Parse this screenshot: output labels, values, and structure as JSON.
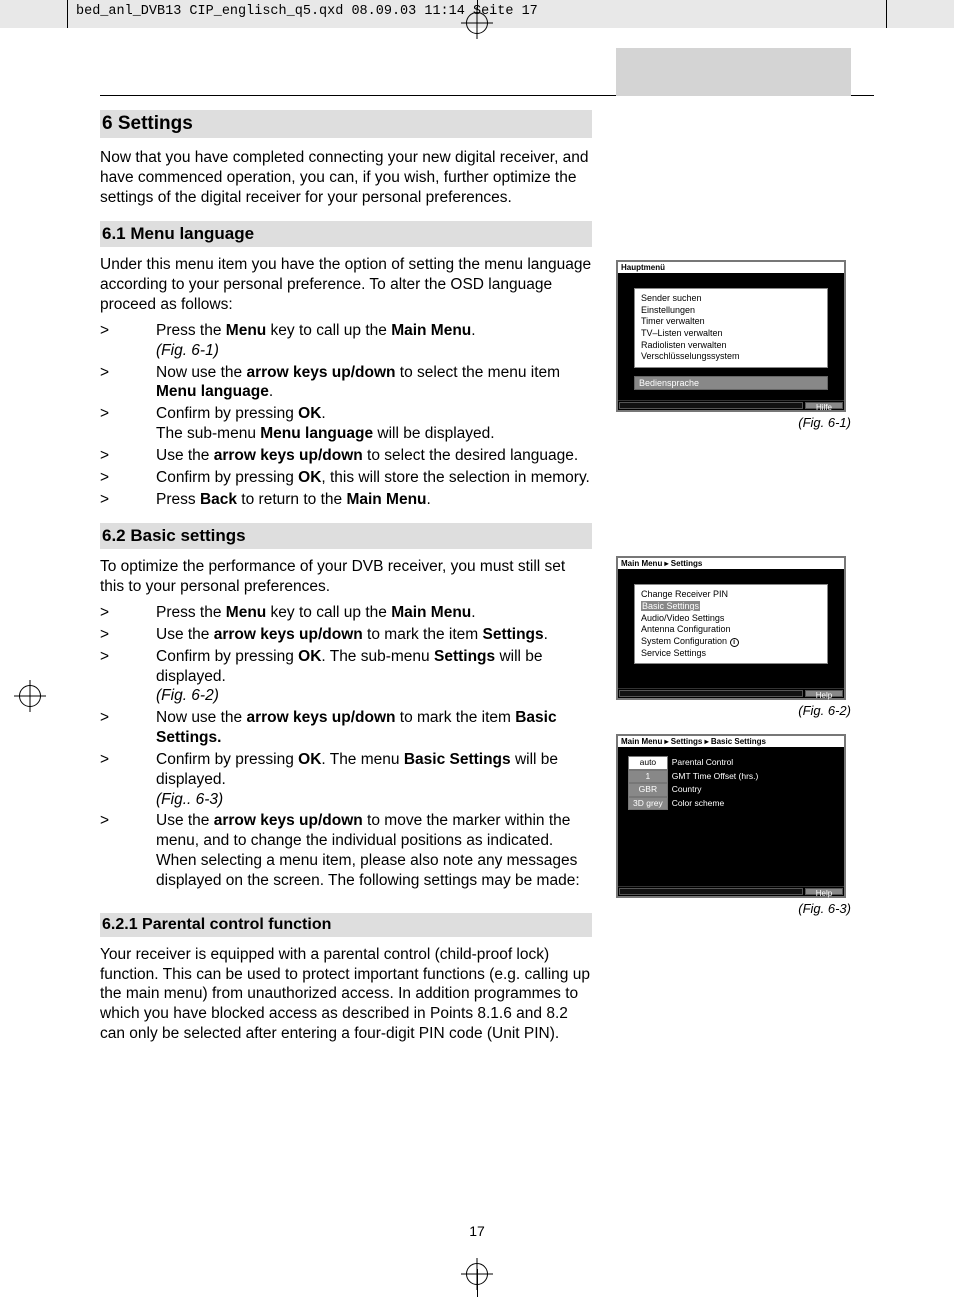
{
  "header_strip": "bed_anl_DVB13 CIP_englisch_q5.qxd  08.09.03  11:14  Seite 17",
  "page_number": "17",
  "section_title": "6 Settings",
  "section_intro": "Now that you have completed connecting your new digital receiver, and have commenced operation, you can, if you wish, further optimize the settings of the digital receiver for your personal preferences.",
  "sub1_title": "6.1 Menu language",
  "sub1_intro": "Under this menu item you have the option of setting the menu language according to your personal preference. To alter the OSD language proceed as follows:",
  "sub1_steps": [
    {
      "pre": "Press the  ",
      "b1": "Menu",
      "mid": " key to call up the  ",
      "b2": "Main Menu",
      "post": ". ",
      "tail_i": "(Fig. 6-1)"
    },
    {
      "pre": "Now use the ",
      "b1": "arrow keys up/down",
      "mid": " to select the menu item ",
      "b2": "Menu language",
      "post": "."
    },
    {
      "pre": "Confirm by pressing ",
      "b1": "OK",
      "mid": ".",
      "post_br": "The sub-menu ",
      "b2": "Menu language",
      "post": " will be displayed."
    },
    {
      "pre": "Use the ",
      "b1": "arrow keys up/down",
      "mid": " to select the desired language.",
      "post": ""
    },
    {
      "pre": "Confirm by pressing ",
      "b1": "OK",
      "mid": ", this will store the selection in memory.",
      "post": ""
    },
    {
      "pre": "Press ",
      "b1": "Back",
      "mid": " to return to the  ",
      "b2": "Main Menu",
      "post": "."
    }
  ],
  "sub2_title": "6.2 Basic settings",
  "sub2_intro": "To optimize the performance of your DVB receiver, you must still set this to your personal preferences.",
  "sub2_steps": [
    {
      "pre": "Press the ",
      "b1": "Menu",
      "mid": " key to call up the ",
      "b2": "Main Menu",
      "post": "."
    },
    {
      "pre": "Use the ",
      "b1": "arrow keys up/down",
      "mid": " to mark the item ",
      "b2": "Settings",
      "post": "."
    },
    {
      "pre": "Confirm by pressing ",
      "b1": "OK",
      "mid": ". The sub-menu ",
      "b2": "Settings",
      "post": " will be displayed. ",
      "tail_i": "(Fig. 6-2)"
    },
    {
      "pre": "Now use the ",
      "b1": "arrow keys up/down",
      "mid": " to mark the item ",
      "b2": "Basic Settings.",
      "post": ""
    },
    {
      "pre": "Confirm by pressing ",
      "b1": "OK",
      "mid": ". The menu ",
      "b2": "Basic Settings",
      "post": " will be displayed. ",
      "tail_i": "(Fig.. 6-3)"
    },
    {
      "pre": "Use the ",
      "b1": "arrow keys up/down",
      "mid": " to move the marker within the menu, and to change the individual positions as indicated. When selecting a menu item, please also note any messages displayed on the screen. The following settings may be made:",
      "post": ""
    }
  ],
  "sub3_title": "6.2.1 Parental control function",
  "sub3_body": "Your receiver is equipped with a parental control  (child-proof lock) function. This can be used to protect important functions (e.g. calling up the main menu) from unauthorized access. In addition programmes to which you have blocked access as described in Points  8.1.6 and 8.2 can only be selected after entering a four-digit PIN code (Unit PIN).",
  "fig1": {
    "title": "Hauptmenü",
    "items": [
      "Sender suchen",
      "Einstellungen",
      "Timer verwalten",
      "TV–Listen verwalten",
      "Radiolisten verwalten",
      "Verschlüsselungssystem"
    ],
    "detached": "Bediensprache",
    "help": "Hilfe",
    "caption": "(Fig. 6-1)"
  },
  "fig2": {
    "title": "Main Menu ▸ Settings",
    "items": [
      "Change Receiver PIN",
      "Basic Settings",
      "Audio/Video Settings",
      "Antenna Configuration",
      "System Configuration",
      "Service Settings"
    ],
    "selected_index": 1,
    "info_index": 4,
    "help": "Help",
    "caption": "(Fig. 6-2)"
  },
  "fig3": {
    "title": "Main Menu ▸ Settings ▸ Basic Settings",
    "rows": [
      {
        "v": "auto",
        "l": "Parental Control",
        "inv": false
      },
      {
        "v": "1",
        "l": "GMT Time Offset (hrs.)",
        "inv": true
      },
      {
        "v": "GBR",
        "l": "Country",
        "inv": true
      },
      {
        "v": "3D grey",
        "l": "Color scheme",
        "inv": true
      }
    ],
    "help": "Help",
    "caption": "(Fig. 6-3)"
  }
}
